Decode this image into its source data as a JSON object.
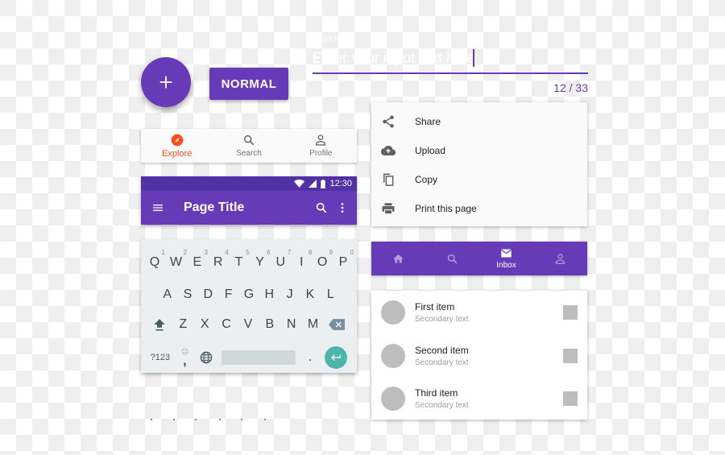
{
  "fab": {
    "icon": "plus-icon",
    "color": "#673ab7"
  },
  "button": {
    "label": "NORMAL"
  },
  "text_field": {
    "label": "Field label",
    "value": "Enter your input text here",
    "counter": "12 / 33",
    "accent": "#673ab7"
  },
  "bottom_nav_light": {
    "active_color": "#f4511e",
    "items": [
      {
        "label": "Explore",
        "icon": "compass-icon",
        "active": true
      },
      {
        "label": "Search",
        "icon": "search-icon",
        "active": false
      },
      {
        "label": "Profile",
        "icon": "person-icon",
        "active": false
      }
    ]
  },
  "app_bar": {
    "status_time": "12:30",
    "title": "Page Title",
    "color": "#673ab7",
    "status_color": "#5131a3"
  },
  "keyboard": {
    "row1": [
      {
        "key": "Q",
        "hint": "1"
      },
      {
        "key": "W",
        "hint": "2"
      },
      {
        "key": "E",
        "hint": "3"
      },
      {
        "key": "R",
        "hint": "4"
      },
      {
        "key": "T",
        "hint": "5"
      },
      {
        "key": "Y",
        "hint": "6"
      },
      {
        "key": "U",
        "hint": "7"
      },
      {
        "key": "I",
        "hint": "8"
      },
      {
        "key": "O",
        "hint": "9"
      },
      {
        "key": "P",
        "hint": "0"
      }
    ],
    "row2": [
      "A",
      "S",
      "D",
      "F",
      "G",
      "H",
      "J",
      "K",
      "L"
    ],
    "row3": [
      "Z",
      "X",
      "C",
      "V",
      "B",
      "N",
      "M"
    ],
    "symbols_label": "?123",
    "comma": ",",
    "period": ".",
    "enter_color": "#4db6ac"
  },
  "menu": {
    "items": [
      {
        "label": "Share",
        "icon": "share-icon"
      },
      {
        "label": "Upload",
        "icon": "cloud-upload-icon"
      },
      {
        "label": "Copy",
        "icon": "copy-icon"
      },
      {
        "label": "Print this page",
        "icon": "print-icon"
      }
    ]
  },
  "bottom_nav_purple": {
    "items": [
      {
        "label": "",
        "icon": "home-icon",
        "active": false
      },
      {
        "label": "",
        "icon": "search-icon",
        "active": false
      },
      {
        "label": "Inbox",
        "icon": "mail-icon",
        "active": true
      },
      {
        "label": "",
        "icon": "person-icon",
        "active": false
      }
    ]
  },
  "list": {
    "items": [
      {
        "primary": "First item",
        "secondary": "Secondary text"
      },
      {
        "primary": "Second item",
        "secondary": "Secondary text"
      },
      {
        "primary": "Third item",
        "secondary": "Secondary text"
      }
    ]
  }
}
